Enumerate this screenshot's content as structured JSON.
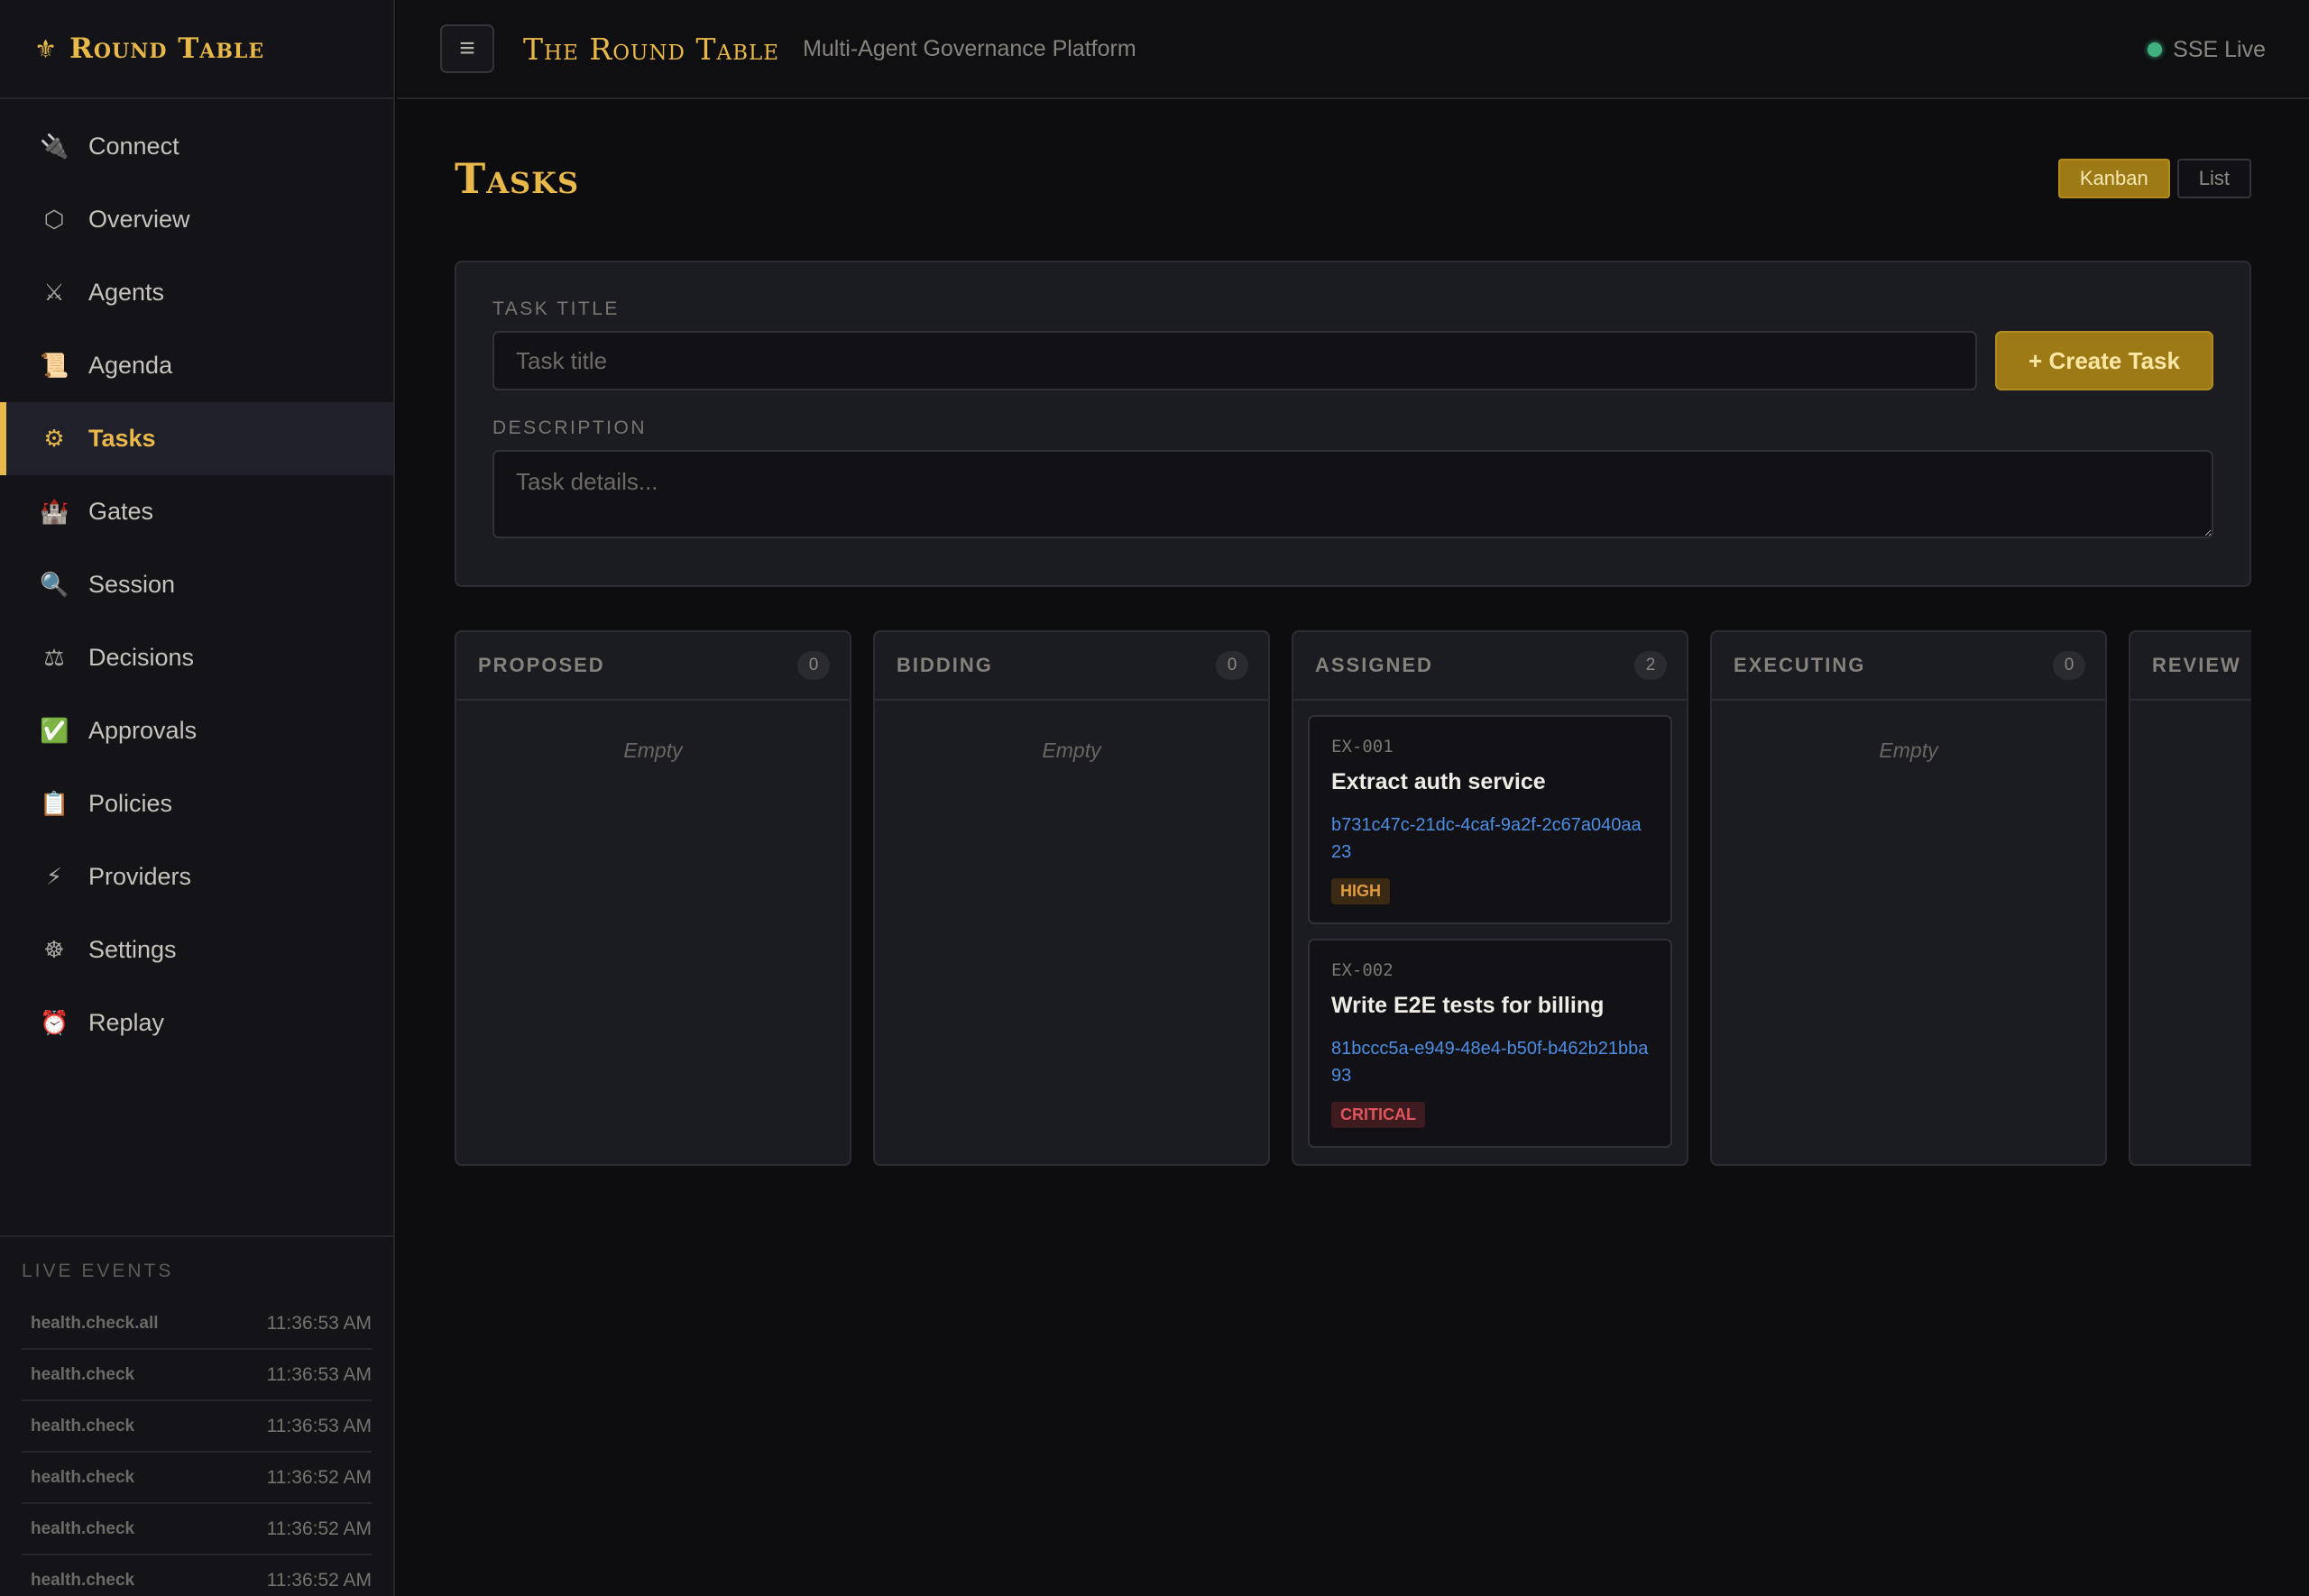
{
  "sidebar": {
    "brand": {
      "icon": "fleur-de-lis-icon",
      "name": "Round Table"
    },
    "items": [
      {
        "key": "connect",
        "label": "Connect",
        "icon": "🔌",
        "active": false
      },
      {
        "key": "overview",
        "label": "Overview",
        "icon": "⬡",
        "active": false
      },
      {
        "key": "agents",
        "label": "Agents",
        "icon": "⚔",
        "active": false
      },
      {
        "key": "agenda",
        "label": "Agenda",
        "icon": "📜",
        "active": false
      },
      {
        "key": "tasks",
        "label": "Tasks",
        "icon": "⚙",
        "active": true
      },
      {
        "key": "gates",
        "label": "Gates",
        "icon": "🏰",
        "active": false
      },
      {
        "key": "session",
        "label": "Session",
        "icon": "🔍",
        "active": false
      },
      {
        "key": "decisions",
        "label": "Decisions",
        "icon": "⚖",
        "active": false
      },
      {
        "key": "approvals",
        "label": "Approvals",
        "icon": "✅",
        "active": false
      },
      {
        "key": "policies",
        "label": "Policies",
        "icon": "📋",
        "active": false
      },
      {
        "key": "providers",
        "label": "Providers",
        "icon": "⚡",
        "active": false
      },
      {
        "key": "settings",
        "label": "Settings",
        "icon": "☸",
        "active": false
      },
      {
        "key": "replay",
        "label": "Replay",
        "icon": "⏰",
        "active": false
      }
    ],
    "live_events": {
      "title": "LIVE EVENTS",
      "events": [
        {
          "name": "health.check.all",
          "time": "11:36:53 AM"
        },
        {
          "name": "health.check",
          "time": "11:36:53 AM"
        },
        {
          "name": "health.check",
          "time": "11:36:53 AM"
        },
        {
          "name": "health.check",
          "time": "11:36:52 AM"
        },
        {
          "name": "health.check",
          "time": "11:36:52 AM"
        },
        {
          "name": "health.check",
          "time": "11:36:52 AM"
        }
      ]
    }
  },
  "topbar": {
    "menu_icon": "≡",
    "title": "The Round Table",
    "subtitle": "Multi-Agent Governance Platform",
    "status": "SSE Live",
    "status_color": "#3fb27f"
  },
  "page": {
    "title": "Tasks",
    "views": {
      "kanban": "Kanban",
      "list": "List",
      "selected": "Kanban"
    }
  },
  "form": {
    "title_label": "TASK TITLE",
    "title_placeholder": "Task title",
    "title_value": "",
    "create_label": "+ Create Task",
    "description_label": "DESCRIPTION",
    "description_placeholder": "Task details...",
    "description_value": ""
  },
  "board": {
    "empty_label": "Empty",
    "columns": [
      {
        "name": "PROPOSED",
        "count": "0",
        "cards": []
      },
      {
        "name": "BIDDING",
        "count": "0",
        "cards": []
      },
      {
        "name": "ASSIGNED",
        "count": "2",
        "cards": [
          {
            "id": "EX-001",
            "title": "Extract auth service",
            "assignee": "b731c47c-21dc-4caf-9a2f-2c67a040aa23",
            "priority": "HIGH"
          },
          {
            "id": "EX-002",
            "title": "Write E2E tests for billing",
            "assignee": "81bccc5a-e949-48e4-b50f-b462b21bba93",
            "priority": "CRITICAL"
          }
        ]
      },
      {
        "name": "EXECUTING",
        "count": "0",
        "cards": []
      },
      {
        "name": "REVIEW",
        "count": "",
        "cards": []
      }
    ]
  },
  "colors": {
    "accent": "#e8b84a",
    "high": "#e09a3e",
    "critical": "#e0545c",
    "link": "#4d8ee3"
  }
}
